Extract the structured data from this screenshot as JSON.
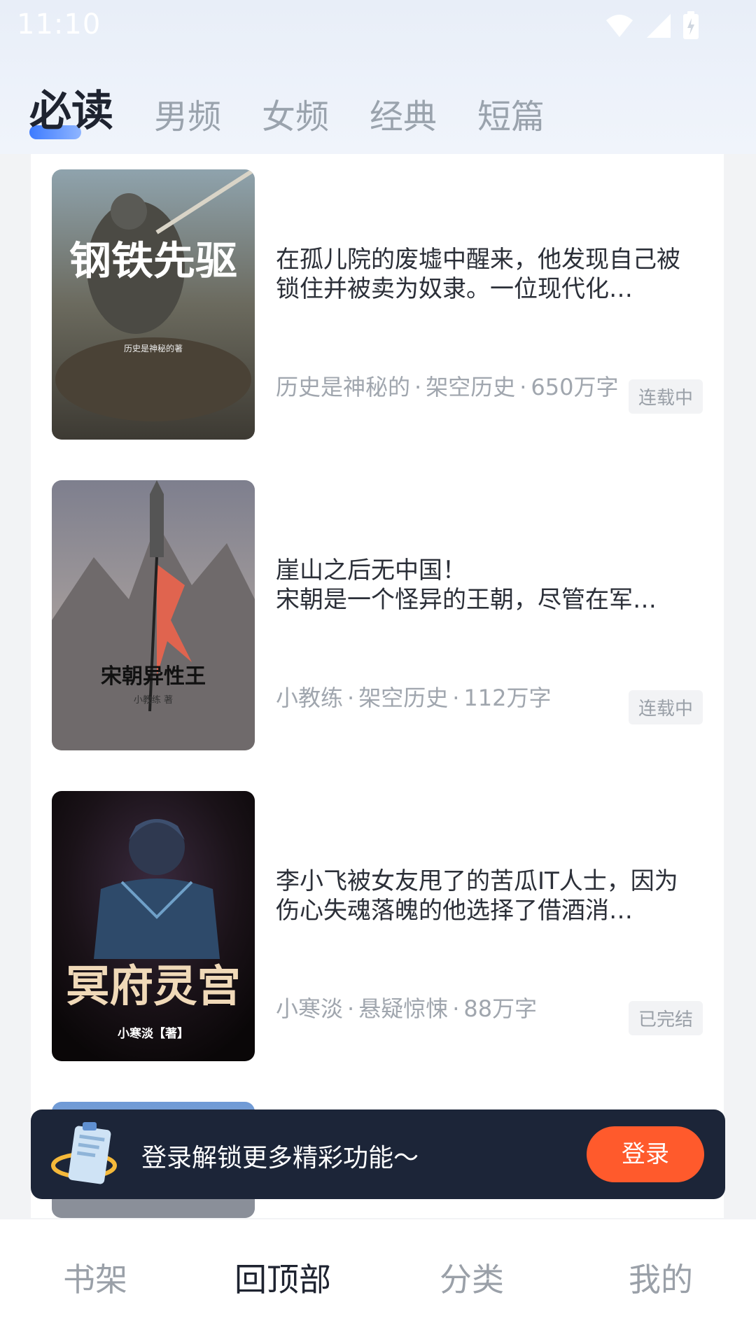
{
  "status_bar": {
    "time": "11:10",
    "icons": [
      "wifi-icon",
      "signal-icon",
      "battery-charging-icon"
    ]
  },
  "tabs": [
    {
      "label": "必读",
      "active": true
    },
    {
      "label": "男频",
      "active": false
    },
    {
      "label": "女频",
      "active": false
    },
    {
      "label": "经典",
      "active": false
    },
    {
      "label": "短篇",
      "active": false
    }
  ],
  "books": [
    {
      "cover_title": "钢铁先驱",
      "cover_author": "历史是神秘的著",
      "description": "在孤儿院的废墟中醒来，他发现自己被锁住并被卖为奴隶。一位现代化…",
      "author": "历史是神秘的",
      "genre": "架空历史",
      "words": "650万字",
      "status": "连载中"
    },
    {
      "cover_title": "宋朝异性王",
      "cover_author": "小教练 著",
      "description": "崖山之后无中国！\n宋朝是一个怪异的王朝，尽管在军…",
      "author": "小教练",
      "genre": "架空历史",
      "words": "112万字",
      "status": "连载中"
    },
    {
      "cover_title": "冥府灵宫",
      "cover_author": "小寒淡【著】",
      "description": "李小飞被女友甩了的苦瓜IT人士，因为伤心失魂落魄的他选择了借酒消…",
      "author": "小寒淡",
      "genre": "悬疑惊悚",
      "words": "88万字",
      "status": "已完结"
    }
  ],
  "login_banner": {
    "text": "登录解锁更多精彩功能～",
    "button": "登录"
  },
  "bottom_nav": [
    {
      "label": "书架",
      "active": false
    },
    {
      "label": "回顶部",
      "active": true
    },
    {
      "label": "分类",
      "active": false
    },
    {
      "label": "我的",
      "active": false
    }
  ],
  "colors": {
    "accent": "#3d7bff",
    "login_button": "#ff5a2c",
    "banner_bg": "#1c2538"
  }
}
